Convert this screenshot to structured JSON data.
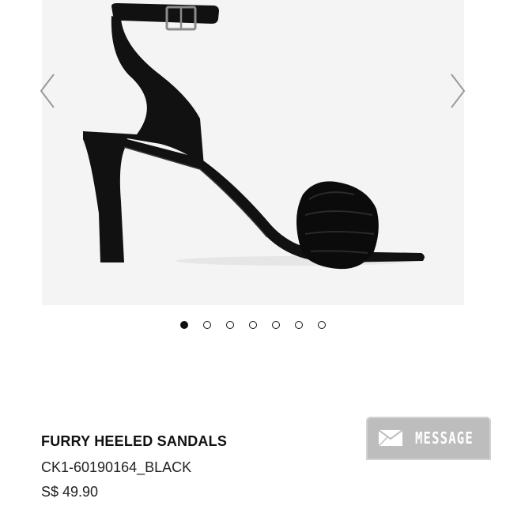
{
  "product": {
    "title": "FURRY HEELED SANDALS",
    "sku": "CK1-60190164_BLACK",
    "price": "S$ 49.90"
  },
  "gallery": {
    "image_subject": "black furry heeled sandal with ankle strap",
    "prev_icon": "chevron-left-icon",
    "next_icon": "chevron-right-icon",
    "total_images": 7,
    "active_index": 0
  },
  "message_button": {
    "label": "MESSAGE",
    "icon": "envelope-icon",
    "background": "#bdbdbd"
  },
  "colors": {
    "image_background": "#f4f4f4",
    "text": "#111111",
    "dot_active": "#111111"
  }
}
